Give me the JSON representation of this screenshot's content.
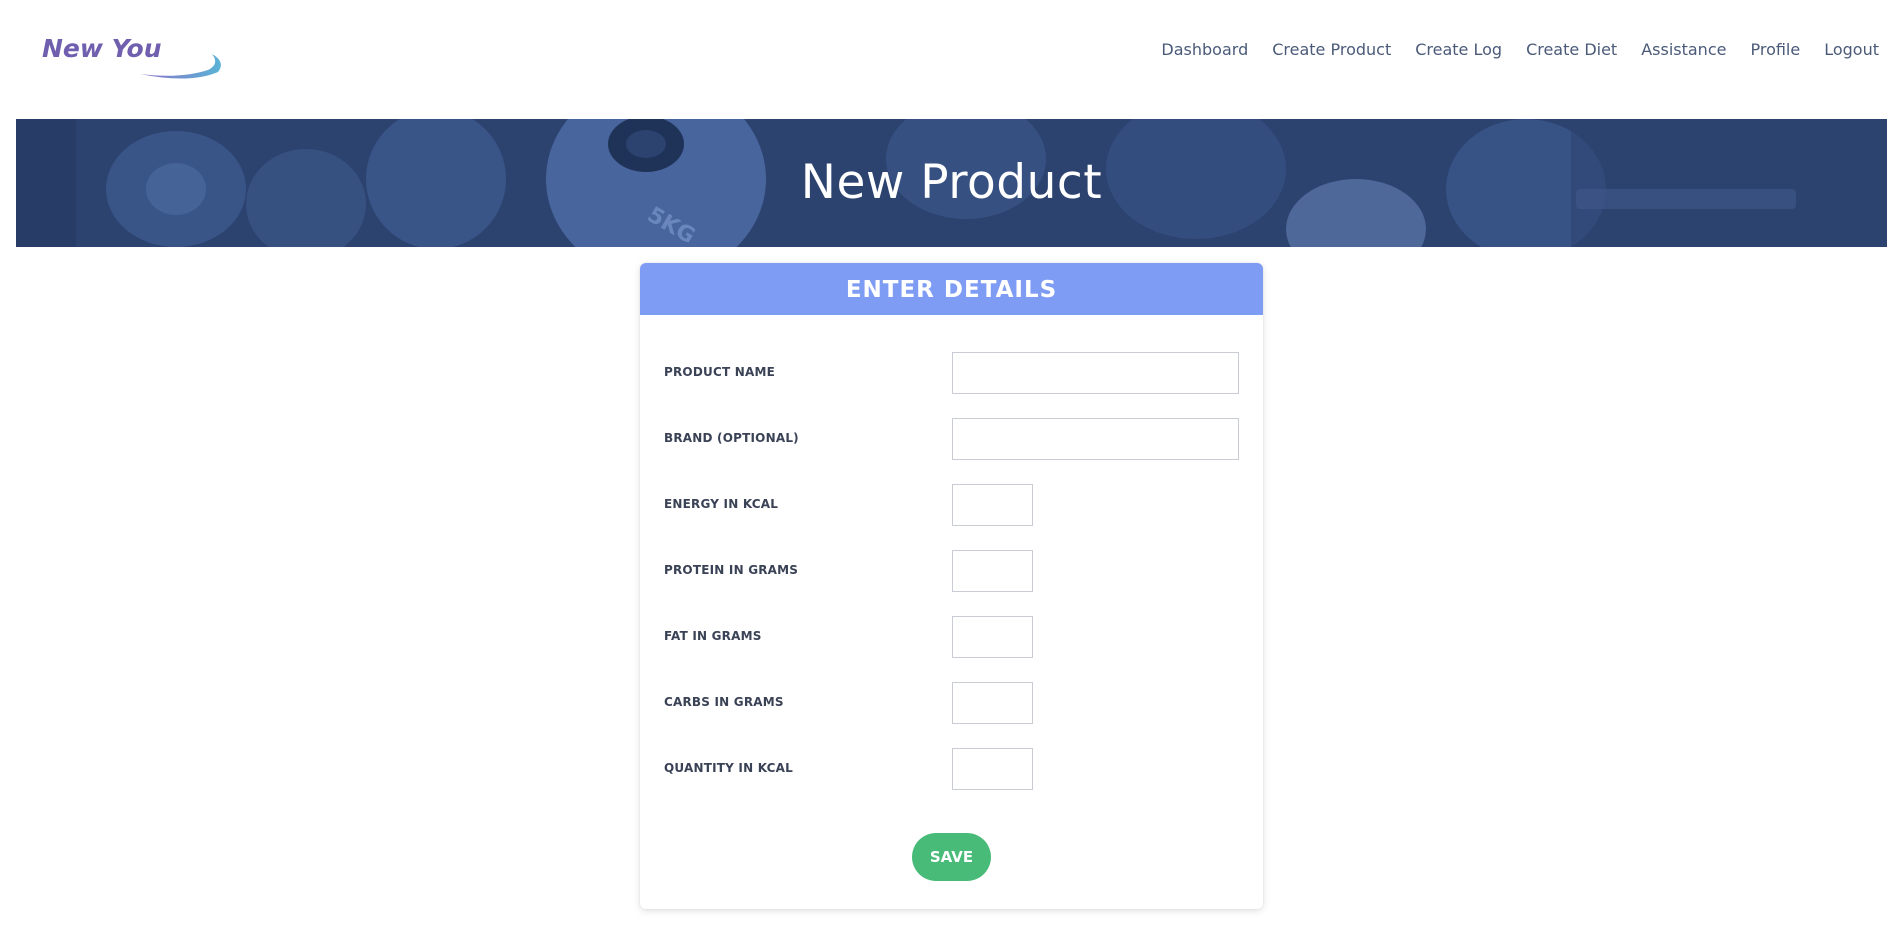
{
  "brand": {
    "name": "New You",
    "logo_color": "#6f5fae",
    "swoosh_colors": [
      "#7b68c0",
      "#5ab3d6"
    ]
  },
  "nav": {
    "items": [
      {
        "label": "Dashboard"
      },
      {
        "label": "Create Product"
      },
      {
        "label": "Create Log"
      },
      {
        "label": "Create Diet"
      },
      {
        "label": "Assistance"
      },
      {
        "label": "Profile"
      },
      {
        "label": "Logout"
      }
    ]
  },
  "hero": {
    "title": "New Product",
    "overlay_color": "#2c4370",
    "plate_label": "5KG"
  },
  "form": {
    "header": "ENTER DETAILS",
    "header_color": "#7f9cf5",
    "fields": [
      {
        "label": "PRODUCT NAME",
        "value": "",
        "placeholder": ""
      },
      {
        "label": "BRAND (OPTIONAL)",
        "value": "",
        "placeholder": ""
      },
      {
        "label": "ENERGY IN KCAL",
        "value": "",
        "placeholder": ""
      },
      {
        "label": "PROTEIN IN GRAMS",
        "value": "",
        "placeholder": ""
      },
      {
        "label": "FAT IN GRAMS",
        "value": "",
        "placeholder": ""
      },
      {
        "label": "CARBS IN GRAMS",
        "value": "",
        "placeholder": ""
      },
      {
        "label": "QUANTITY IN KCAL",
        "value": "",
        "placeholder": ""
      }
    ],
    "save_label": "SAVE",
    "save_color": "#48bb78"
  }
}
